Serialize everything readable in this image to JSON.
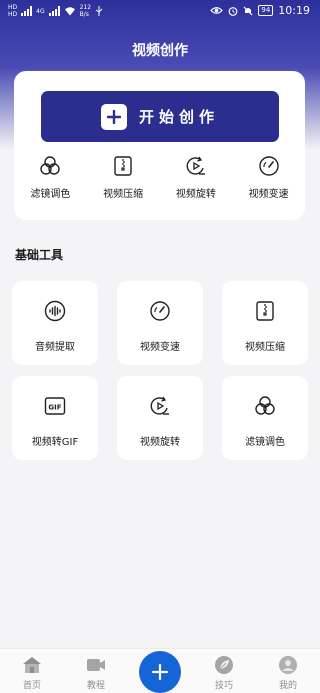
{
  "status_bar": {
    "net_left": "HD",
    "net_right": "4G",
    "speed_value": "212",
    "speed_unit": "B/s",
    "battery": "94",
    "time": "10:19"
  },
  "header": {
    "title": "视频创作"
  },
  "start_button": {
    "label": "开始创作"
  },
  "quick_tools": [
    {
      "label": "滤镜调色",
      "icon": "filter-icon"
    },
    {
      "label": "视频压缩",
      "icon": "compress-icon"
    },
    {
      "label": "视频旋转",
      "icon": "rotate-icon"
    },
    {
      "label": "视频变速",
      "icon": "speed-icon"
    }
  ],
  "section": {
    "title": "基础工具"
  },
  "tools": [
    {
      "label": "音频提取",
      "icon": "audio-wave-icon"
    },
    {
      "label": "视频变速",
      "icon": "speed-icon"
    },
    {
      "label": "视频压缩",
      "icon": "compress-icon"
    },
    {
      "label": "视频转GIF",
      "icon": "gif-icon"
    },
    {
      "label": "视频旋转",
      "icon": "rotate-icon"
    },
    {
      "label": "滤镜调色",
      "icon": "filter-icon"
    }
  ],
  "tabbar": {
    "items": [
      {
        "label": "首页",
        "icon": "home-icon"
      },
      {
        "label": "教程",
        "icon": "video-icon"
      },
      {
        "label": "技巧",
        "icon": "leaf-icon"
      },
      {
        "label": "我的",
        "icon": "user-icon"
      }
    ],
    "fab_icon": "plus-icon"
  },
  "colors": {
    "brand": "#2b2e8f",
    "fab": "#1565d8",
    "tab_inactive": "#8e8e8e"
  }
}
